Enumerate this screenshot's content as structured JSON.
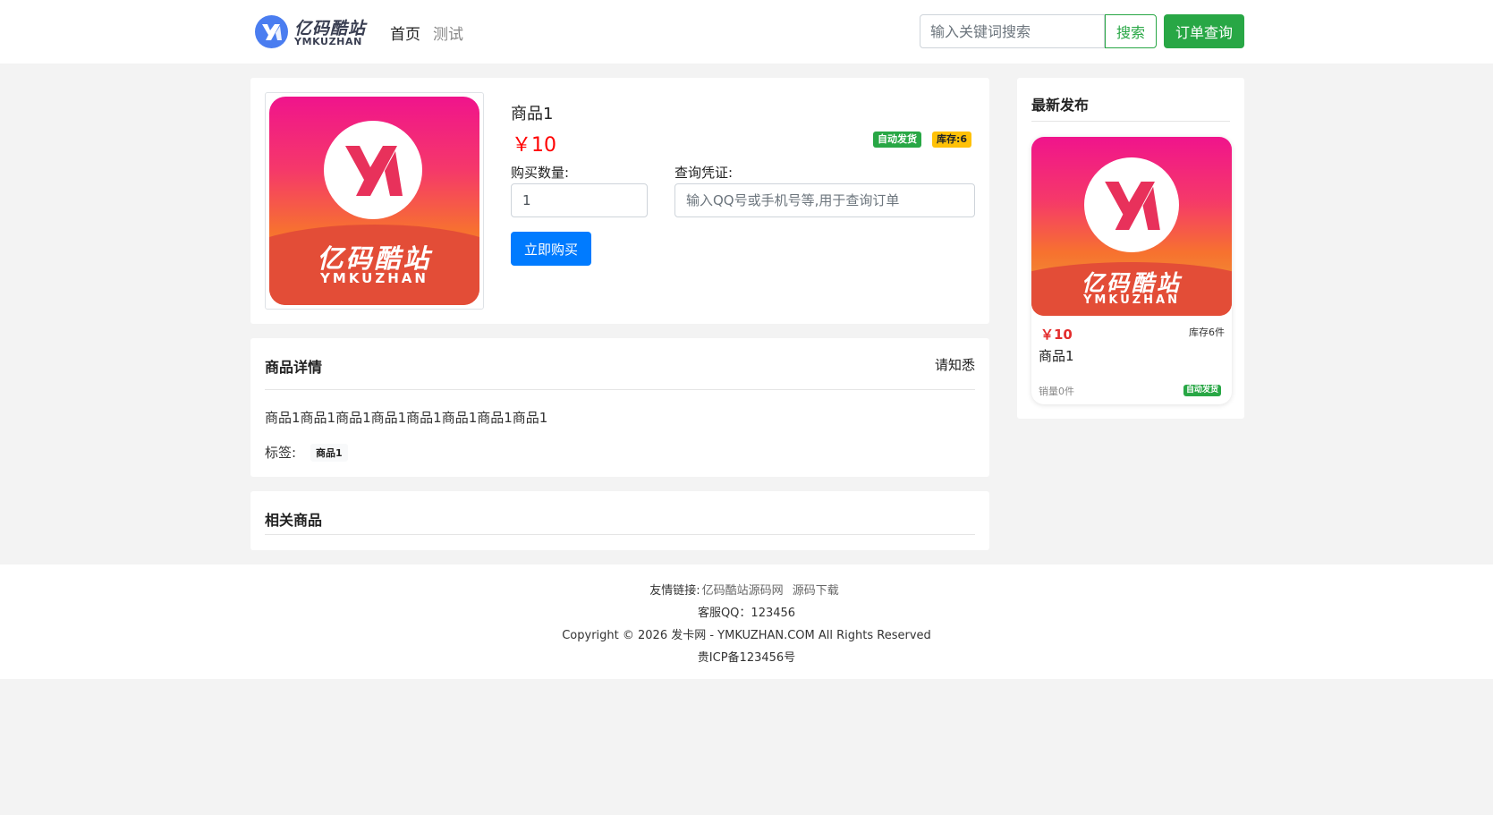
{
  "header": {
    "logo_cn": "亿码酷站",
    "logo_en": "YMKUZHAN",
    "nav": [
      {
        "label": "首页"
      },
      {
        "label": "测试"
      }
    ],
    "search_placeholder": "输入关键词搜索",
    "search_label": "搜索",
    "order_query_label": "订单查询"
  },
  "product": {
    "name": "商品1",
    "price": "￥10",
    "badge_auto": "自动发货",
    "badge_stock": "库存:6",
    "qty_label": "购买数量:",
    "qty_value": "1",
    "contact_label": "查询凭证:",
    "contact_placeholder": "输入QQ号或手机号等,用于查询订单",
    "buy_label": "立即购买",
    "image_cn": "亿码酷站",
    "image_en": "YMKUZHAN"
  },
  "detail": {
    "title": "商品详情",
    "notice_label": "请知悉",
    "description": "商品1商品1商品1商品1商品1商品1商品1商品1",
    "tags_label": "标签:",
    "tags": [
      "商品1"
    ]
  },
  "related": {
    "title": "相关商品"
  },
  "sidebar": {
    "title": "最新发布",
    "items": [
      {
        "price": "￥10",
        "stock": "库存6件",
        "name": "商品1",
        "sales": "销量0件",
        "badge": "自动发货",
        "image_cn": "亿码酷站",
        "image_en": "YMKUZHAN"
      }
    ]
  },
  "footer": {
    "links_label": "友情链接:",
    "links": [
      "亿码酷站源码网",
      "源码下载"
    ],
    "qq": "客服QQ：123456",
    "copyright": "Copyright © 2026 发卡网 - YMKUZHAN.COM All Rights Reserved",
    "icp": "贵ICP备123456号"
  },
  "colors": {
    "primary": "#007bff",
    "success": "#28a745",
    "warning": "#ffc107",
    "price": "#ff0000",
    "background": "#f3f3f3"
  }
}
